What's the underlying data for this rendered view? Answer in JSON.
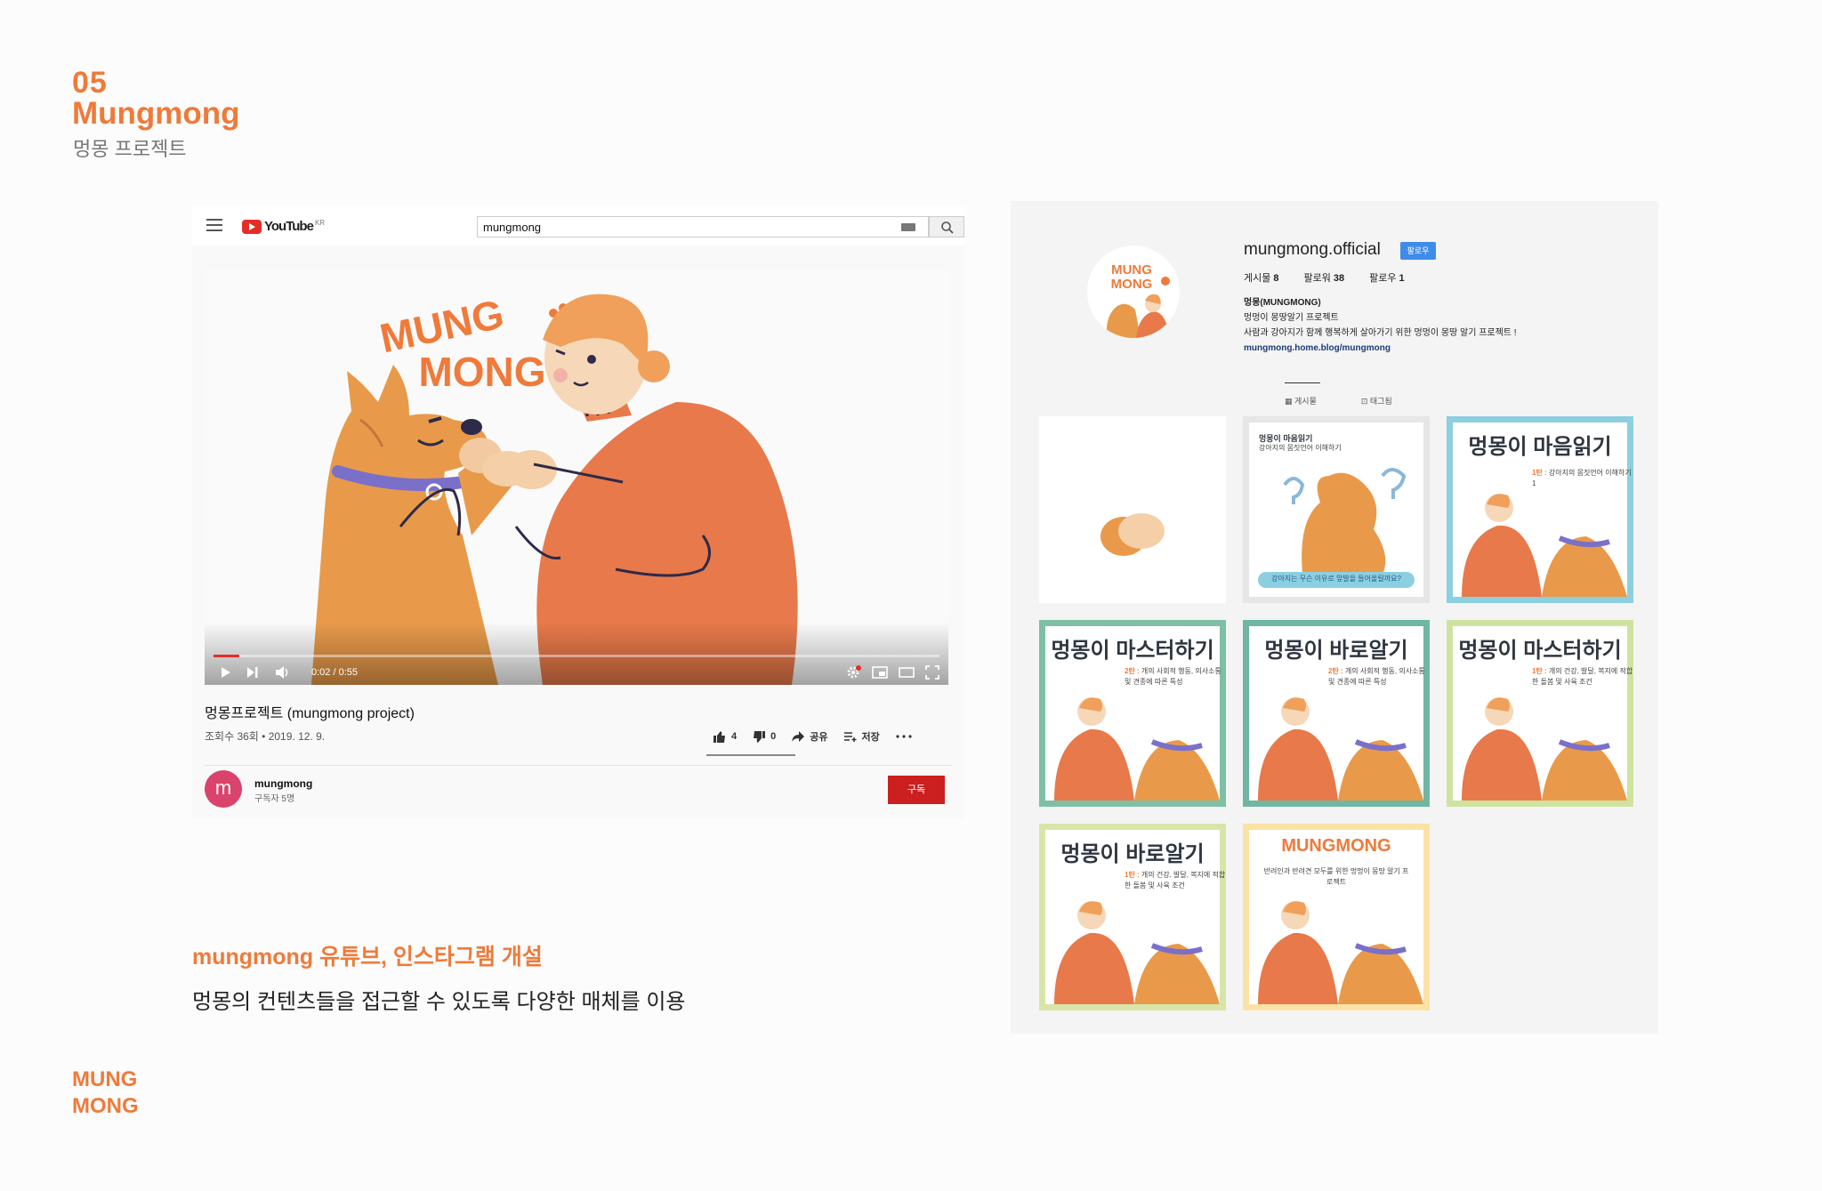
{
  "header": {
    "number": "05",
    "name": "Mungmong",
    "subtitle": "멍몽 프로젝트"
  },
  "youtube": {
    "logo_text": "YouTube",
    "logo_region": "KR",
    "search_value": "mungmong",
    "video": {
      "logo_line1": "MUNG",
      "logo_line2": "MONG",
      "time": "0:02 / 0:55",
      "progress": 0.036
    },
    "title": "멍몽프로젝트 (mungmong project)",
    "meta": "조회수 36회 • 2019. 12. 9.",
    "likes": "4",
    "dislikes": "0",
    "share_label": "공유",
    "save_label": "저장",
    "channel_initial": "m",
    "channel_name": "mungmong",
    "subscribers": "구독자 5명",
    "subscribe_label": "구독"
  },
  "caption": {
    "title": "mungmong 유튜브, 인스타그램 개설",
    "body": "멍몽의 컨텐츠들을 접근할 수 있도록 다양한 매체를 이용"
  },
  "footer_logo": {
    "line1": "MUNG",
    "line2": "MONG"
  },
  "instagram": {
    "avatar_text1": "MUNG",
    "avatar_text2": "MONG",
    "username": "mungmong.official",
    "follow_label": "팔로우",
    "stats": {
      "posts_label": "게시물",
      "posts": "8",
      "followers_label": "팔로워",
      "followers": "38",
      "following_label": "팔로우",
      "following": "1"
    },
    "bio_name": "멍몽(MUNGMONG)",
    "bio_line1": "멍멍이 몽땅알기 프로젝트",
    "bio_line2": "사람과 강아지가 함께 행복하게 살아가기 위한 멍멍이 몽땅 알기 프로젝트 !",
    "bio_link": "mungmong.home.blog/mungmong",
    "tab_posts": "게시물",
    "tab_tagged": "태그됨",
    "tiles": [
      {
        "title": "",
        "sub_num": "",
        "sub": "",
        "border": "#ffffff"
      },
      {
        "title": "멍몽이 마음읽기",
        "sub_num": "",
        "sub": "강아지의 몸짓언어 이해하기",
        "bottom": "강아지는 무슨 이유로 앞발을 들어올릴까요?",
        "border": "#e6e6e6"
      },
      {
        "title": "멍몽이 마음읽기",
        "sub_num": "1탄 :",
        "sub": "강아지의 몸짓언어 이해하기 1",
        "border": "#8ccfe0"
      },
      {
        "title": "멍몽이 마스터하기",
        "sub_num": "2탄 :",
        "sub": "개의 사회적 행동, 의사소통 및 견종에 따른 특성",
        "border": "#7fbfa6"
      },
      {
        "title": "멍몽이 바로알기",
        "sub_num": "2탄 :",
        "sub": "개의 사회적 행동, 의사소통 및 견종에 따른 특성",
        "border": "#6fb7a3"
      },
      {
        "title": "멍몽이 마스터하기",
        "sub_num": "1탄 :",
        "sub": "개의 건강, 발달, 복지에 적합한 돌봄 및 사육 조건",
        "border": "#cfe3a1"
      },
      {
        "title": "멍몽이 바로알기",
        "sub_num": "1탄 :",
        "sub": "개의 건강, 발달, 복지에 적합한 돌봄 및 사육 조건",
        "border": "#d7e6a8"
      },
      {
        "title": "MUNGMONG",
        "sub_num": "",
        "sub": "반려인과 반려견 모두를 위한 멍멍이 몽땅 알기 프로젝트",
        "border": "#fbe3a6"
      }
    ]
  },
  "colors": {
    "accent": "#ef7a3a",
    "yt_red": "#e52d27",
    "subscribe_red": "#cc1f1f",
    "ig_blue": "#3f8ce8",
    "dog": "#e89a4a",
    "sweater": "#e8794a"
  }
}
